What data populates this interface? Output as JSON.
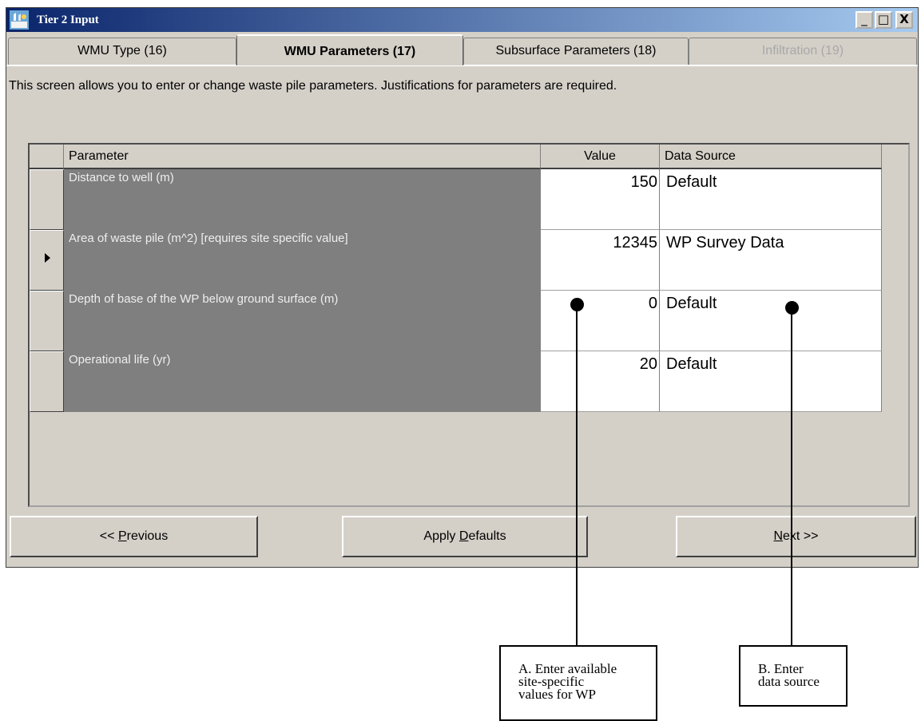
{
  "window": {
    "title": "Tier 2 Input",
    "controls": {
      "minimize": "_",
      "maximize": "□",
      "close": "X"
    }
  },
  "tabs": [
    {
      "label": "WMU Type (16)",
      "state": "normal"
    },
    {
      "label": "WMU Parameters (17)",
      "state": "active"
    },
    {
      "label": "Subsurface Parameters (18)",
      "state": "normal"
    },
    {
      "label": "Infiltration (19)",
      "state": "disabled"
    }
  ],
  "instructions": "This screen allows you to enter or change waste pile parameters.  Justifications for parameters are required.",
  "grid": {
    "headers": {
      "parameter": "Parameter",
      "value": "Value",
      "source": "Data Source"
    },
    "rows": [
      {
        "parameter": "Distance to well (m)",
        "value": "150",
        "source": "Default"
      },
      {
        "parameter": "Area of waste pile (m^2) [requires site specific value]",
        "value": "12345",
        "source": "WP Survey Data"
      },
      {
        "parameter": "Depth of base of the WP below ground surface (m)",
        "value": "0",
        "source": "Default"
      },
      {
        "parameter": "Operational life (yr)",
        "value": "20",
        "source": "Default"
      }
    ],
    "selected_row_index": 1
  },
  "buttons": {
    "previous": {
      "prefix": "<< ",
      "mnemonic": "P",
      "rest": "revious"
    },
    "apply_defaults": {
      "prefix": "Apply ",
      "mnemonic": "D",
      "rest": "efaults"
    },
    "next": {
      "prefix": "",
      "mnemonic": "N",
      "rest": "ext >>"
    }
  },
  "annotations": {
    "a": {
      "line1": "A. Enter available",
      "line2": "site-specific",
      "line3": "values for WP"
    },
    "b": {
      "line1": "B. Enter",
      "line2": "data source"
    }
  },
  "colors": {
    "titlebar_start": "#0a246a",
    "titlebar_end": "#a6caf0",
    "dialog_face": "#d4d0c8",
    "parameter_cell_bg": "#7f7f7f"
  }
}
